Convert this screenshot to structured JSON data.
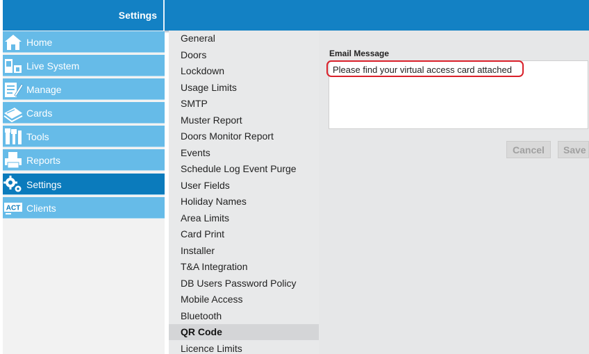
{
  "header": {
    "title": "Settings"
  },
  "sidebar": {
    "items": [
      {
        "label": "Home",
        "icon": "home-icon"
      },
      {
        "label": "Live System",
        "icon": "live-system-icon"
      },
      {
        "label": "Manage",
        "icon": "manage-icon"
      },
      {
        "label": "Cards",
        "icon": "cards-icon"
      },
      {
        "label": "Tools",
        "icon": "tools-icon"
      },
      {
        "label": "Reports",
        "icon": "reports-icon"
      },
      {
        "label": "Settings",
        "icon": "settings-gear-icon",
        "active": true
      },
      {
        "label": "Clients",
        "icon": "act-clients-icon"
      }
    ]
  },
  "submenu": {
    "items": [
      "General",
      "Doors",
      "Lockdown",
      "Usage Limits",
      "SMTP",
      "Muster Report",
      "Doors Monitor Report",
      "Events",
      "Schedule Log Event Purge",
      "User Fields",
      "Holiday Names",
      "Area Limits",
      "Card Print",
      "Installer",
      "T&A Integration",
      "DB Users Password Policy",
      "Mobile Access",
      "Bluetooth",
      "QR Code",
      "Licence Limits"
    ],
    "active": "QR Code"
  },
  "content": {
    "email_label": "Email Message",
    "email_value": "Please find your virtual access card attached",
    "cancel_label": "Cancel",
    "save_label": "Save"
  },
  "colors": {
    "header_blue": "#1381c4",
    "nav_blue": "#66bbe8",
    "nav_active": "#0b7bbc",
    "highlight_red": "#d9202a"
  }
}
